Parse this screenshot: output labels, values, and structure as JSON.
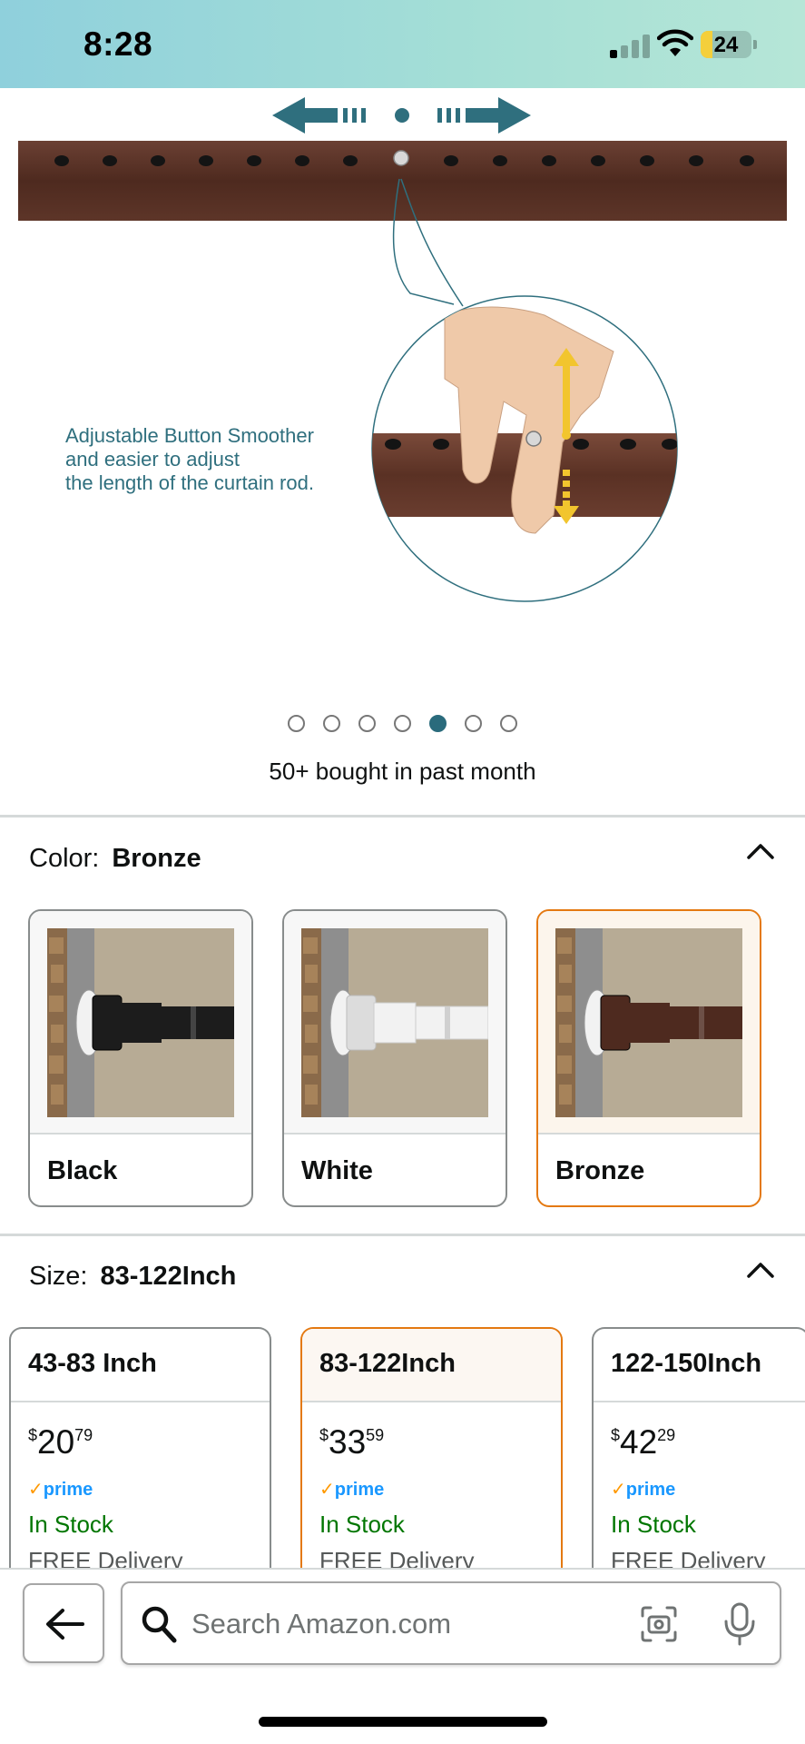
{
  "status_bar": {
    "time": "8:28",
    "battery_level": "24",
    "battery_fraction": 0.24,
    "signal_bars_active": 1,
    "signal_bars_total": 4
  },
  "product_image": {
    "caption_lines": [
      "Adjustable Button Smoother",
      "and easier to adjust",
      "the length of the curtain rod."
    ],
    "carousel_count": 7,
    "carousel_active_index": 4
  },
  "social_proof": "50+ bought in past month",
  "color_section": {
    "label": "Color:",
    "selected": "Bronze",
    "collapse_icon": "chevron-up-icon",
    "options": [
      {
        "name": "Black",
        "rod_color": "#1c1c1c"
      },
      {
        "name": "White",
        "rod_color": "#f2f2f2"
      },
      {
        "name": "Bronze",
        "rod_color": "#4e2a1f"
      }
    ],
    "selected_index": 2
  },
  "size_section": {
    "label": "Size:",
    "selected": "83-122Inch",
    "collapse_icon": "chevron-up-icon",
    "options": [
      {
        "title": "43-83 Inch",
        "currency": "$",
        "price_whole": "20",
        "price_fraction": "79",
        "prime": "prime",
        "stock": "In Stock",
        "delivery": "FREE Delivery"
      },
      {
        "title": "83-122Inch",
        "currency": "$",
        "price_whole": "33",
        "price_fraction": "59",
        "prime": "prime",
        "stock": "In Stock",
        "delivery": "FREE Delivery"
      },
      {
        "title": "122-150Inch",
        "currency": "$",
        "price_whole": "42",
        "price_fraction": "29",
        "prime": "prime",
        "stock": "In Stock",
        "delivery": "FREE Delivery"
      }
    ],
    "selected_index": 1
  },
  "search_bar": {
    "placeholder": "Search Amazon.com",
    "value": "",
    "icons": [
      "back-arrow-icon",
      "search-icon",
      "camera-scan-icon",
      "microphone-icon"
    ]
  },
  "colors": {
    "accent_selected": "#e47911",
    "prime_blue": "#1a98ff",
    "in_stock_green": "#007600",
    "bronze_rod": "#4e2a1f",
    "teal_graphic": "#2a6b7c"
  }
}
